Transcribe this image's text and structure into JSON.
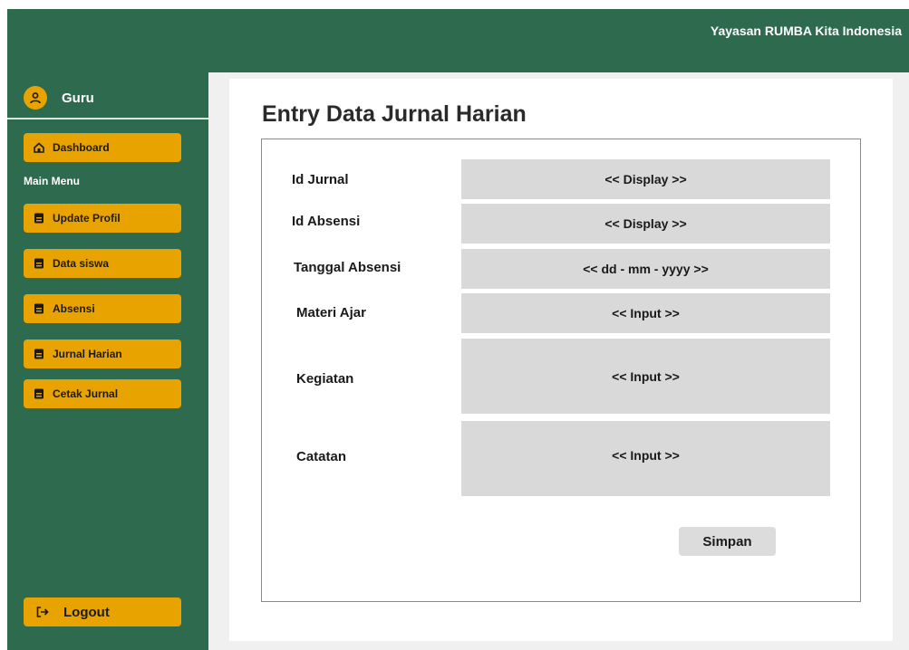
{
  "header": {
    "org_name": "Yayasan RUMBA Kita Indonesia"
  },
  "sidebar": {
    "user_role": "Guru",
    "dashboard_label": "Dashboard",
    "section_label": "Main Menu",
    "items": [
      {
        "label": "Update Profil"
      },
      {
        "label": "Data siswa"
      },
      {
        "label": "Absensi"
      },
      {
        "label": "Jurnal Harian"
      },
      {
        "label": "Cetak Jurnal"
      }
    ],
    "logout_label": "Logout"
  },
  "main": {
    "title": "Entry Data Jurnal Harian",
    "fields": [
      {
        "label": "Id Jurnal",
        "value": "<< Display >>"
      },
      {
        "label": "Id Absensi",
        "value": "<< Display >>"
      },
      {
        "label": "Tanggal Absensi",
        "value": "<< dd - mm - yyyy >>"
      },
      {
        "label": "Materi Ajar",
        "value": "<< Input >>"
      },
      {
        "label": "Kegiatan",
        "value": "<< Input >>"
      },
      {
        "label": "Catatan",
        "value": "<< Input >>"
      }
    ],
    "save_label": "Simpan"
  },
  "colors": {
    "primary_green": "#2e6a4e",
    "accent_yellow": "#e8a300",
    "field_gray": "#d9d9d9"
  },
  "icons": {
    "user": "user-icon",
    "dashboard": "home-icon",
    "menu_item": "document-icon",
    "logout": "logout-icon"
  }
}
